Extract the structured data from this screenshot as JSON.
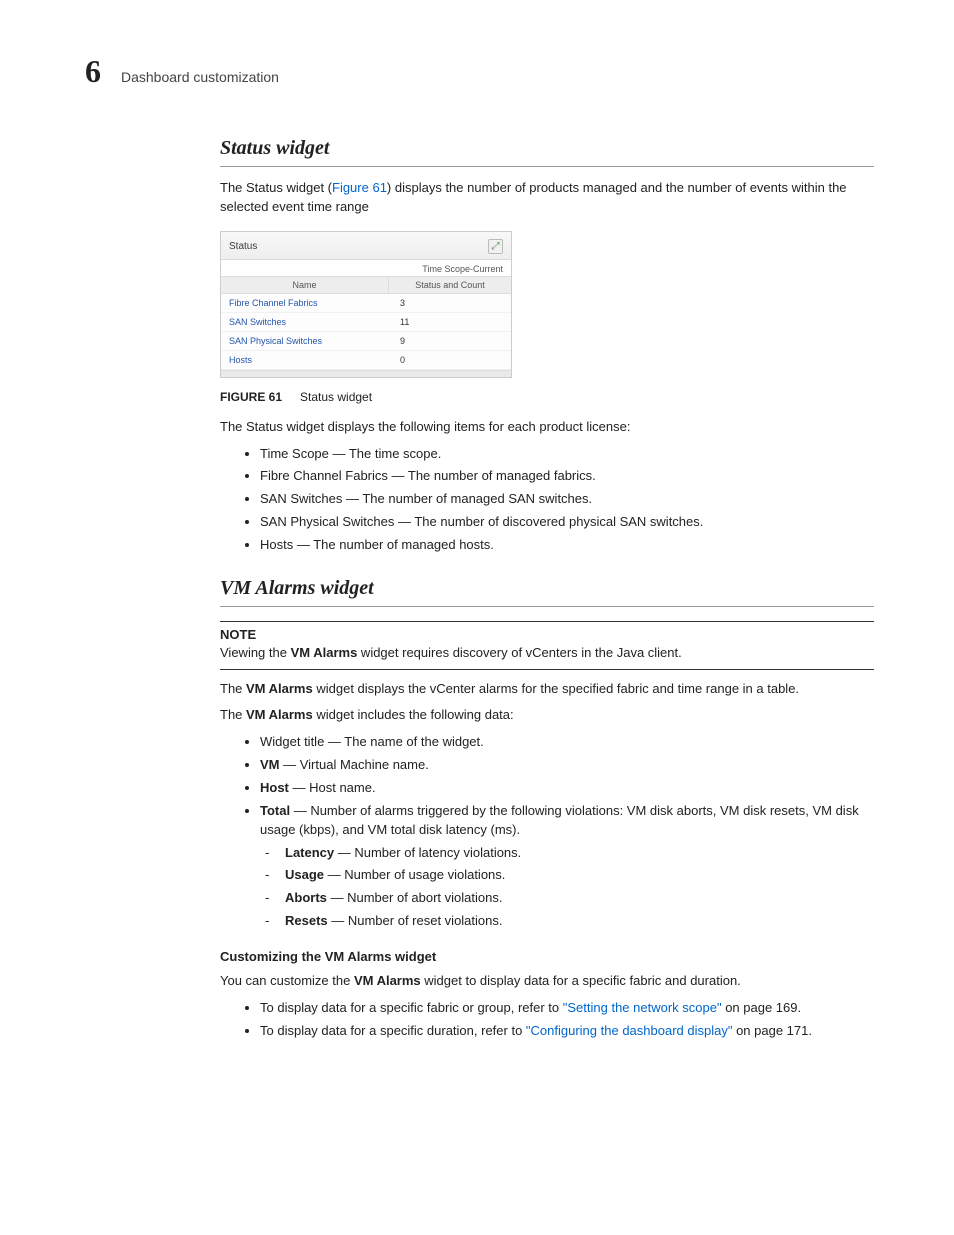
{
  "header": {
    "chapter_number": "6",
    "chapter_title": "Dashboard customization"
  },
  "sections": {
    "status_widget": {
      "heading": "Status widget",
      "intro_pre": "The Status widget (",
      "intro_link": "Figure 61",
      "intro_post": ") displays the number of products managed and the number of events within the selected event time range",
      "figure": {
        "widget_title": "Status",
        "time_scope": "Time Scope-Current",
        "col_name": "Name",
        "col_status": "Status and Count",
        "rows": [
          {
            "name": "Fibre Channel Fabrics",
            "count": "3"
          },
          {
            "name": "SAN Switches",
            "count": "11"
          },
          {
            "name": "SAN Physical Switches",
            "count": "9"
          },
          {
            "name": "Hosts",
            "count": "0"
          }
        ],
        "caption_label": "FIGURE 61",
        "caption_text": "Status widget"
      },
      "para_after": "The Status widget displays the following items for each product license:",
      "items": [
        {
          "text": "Time Scope — The time scope."
        },
        {
          "text": "Fibre Channel Fabrics — The number of managed fabrics."
        },
        {
          "text": "SAN Switches — The number of managed SAN switches."
        },
        {
          "text": "SAN Physical Switches — The number of discovered physical SAN switches."
        },
        {
          "text": "Hosts — The number of managed hosts."
        }
      ]
    },
    "vm_alarms": {
      "heading": "VM Alarms widget",
      "note": {
        "head": "NOTE",
        "pre": "Viewing the ",
        "bold": "VM Alarms",
        "post": " widget requires discovery of vCenters in the Java client."
      },
      "p1_pre": "The ",
      "p1_bold": "VM Alarms",
      "p1_post": " widget displays the vCenter alarms for the specified fabric and time range in a table.",
      "p2_pre": "The ",
      "p2_bold": "VM Alarms",
      "p2_post": " widget includes the following data:",
      "items": [
        {
          "text": "Widget title — The name of the widget."
        },
        {
          "bold": "VM",
          "rest": " — Virtual Machine name."
        },
        {
          "bold": "Host",
          "rest": " — Host name."
        },
        {
          "bold": "Total",
          "rest": " — Number of alarms triggered by the following violations: VM disk aborts, VM disk resets, VM disk usage (kbps), and VM total disk latency (ms)."
        }
      ],
      "subitems": [
        {
          "bold": "Latency",
          "rest": " — Number of latency violations."
        },
        {
          "bold": "Usage",
          "rest": " — Number of usage violations."
        },
        {
          "bold": "Aborts",
          "rest": " — Number of abort violations."
        },
        {
          "bold": "Resets",
          "rest": " — Number of reset violations."
        }
      ],
      "custom_head": "Customizing the VM Alarms widget",
      "custom_p_pre": "You can customize the ",
      "custom_p_bold": "VM Alarms",
      "custom_p_post": " widget to display data for a specific fabric and duration.",
      "custom_items": [
        {
          "pre": "To display data for a specific fabric or group, refer to ",
          "link": "\"Setting the network scope\"",
          "post": " on page 169."
        },
        {
          "pre": "To display data for a specific duration, refer to ",
          "link": "\"Configuring the dashboard display\"",
          "post": " on page 171."
        }
      ]
    }
  }
}
